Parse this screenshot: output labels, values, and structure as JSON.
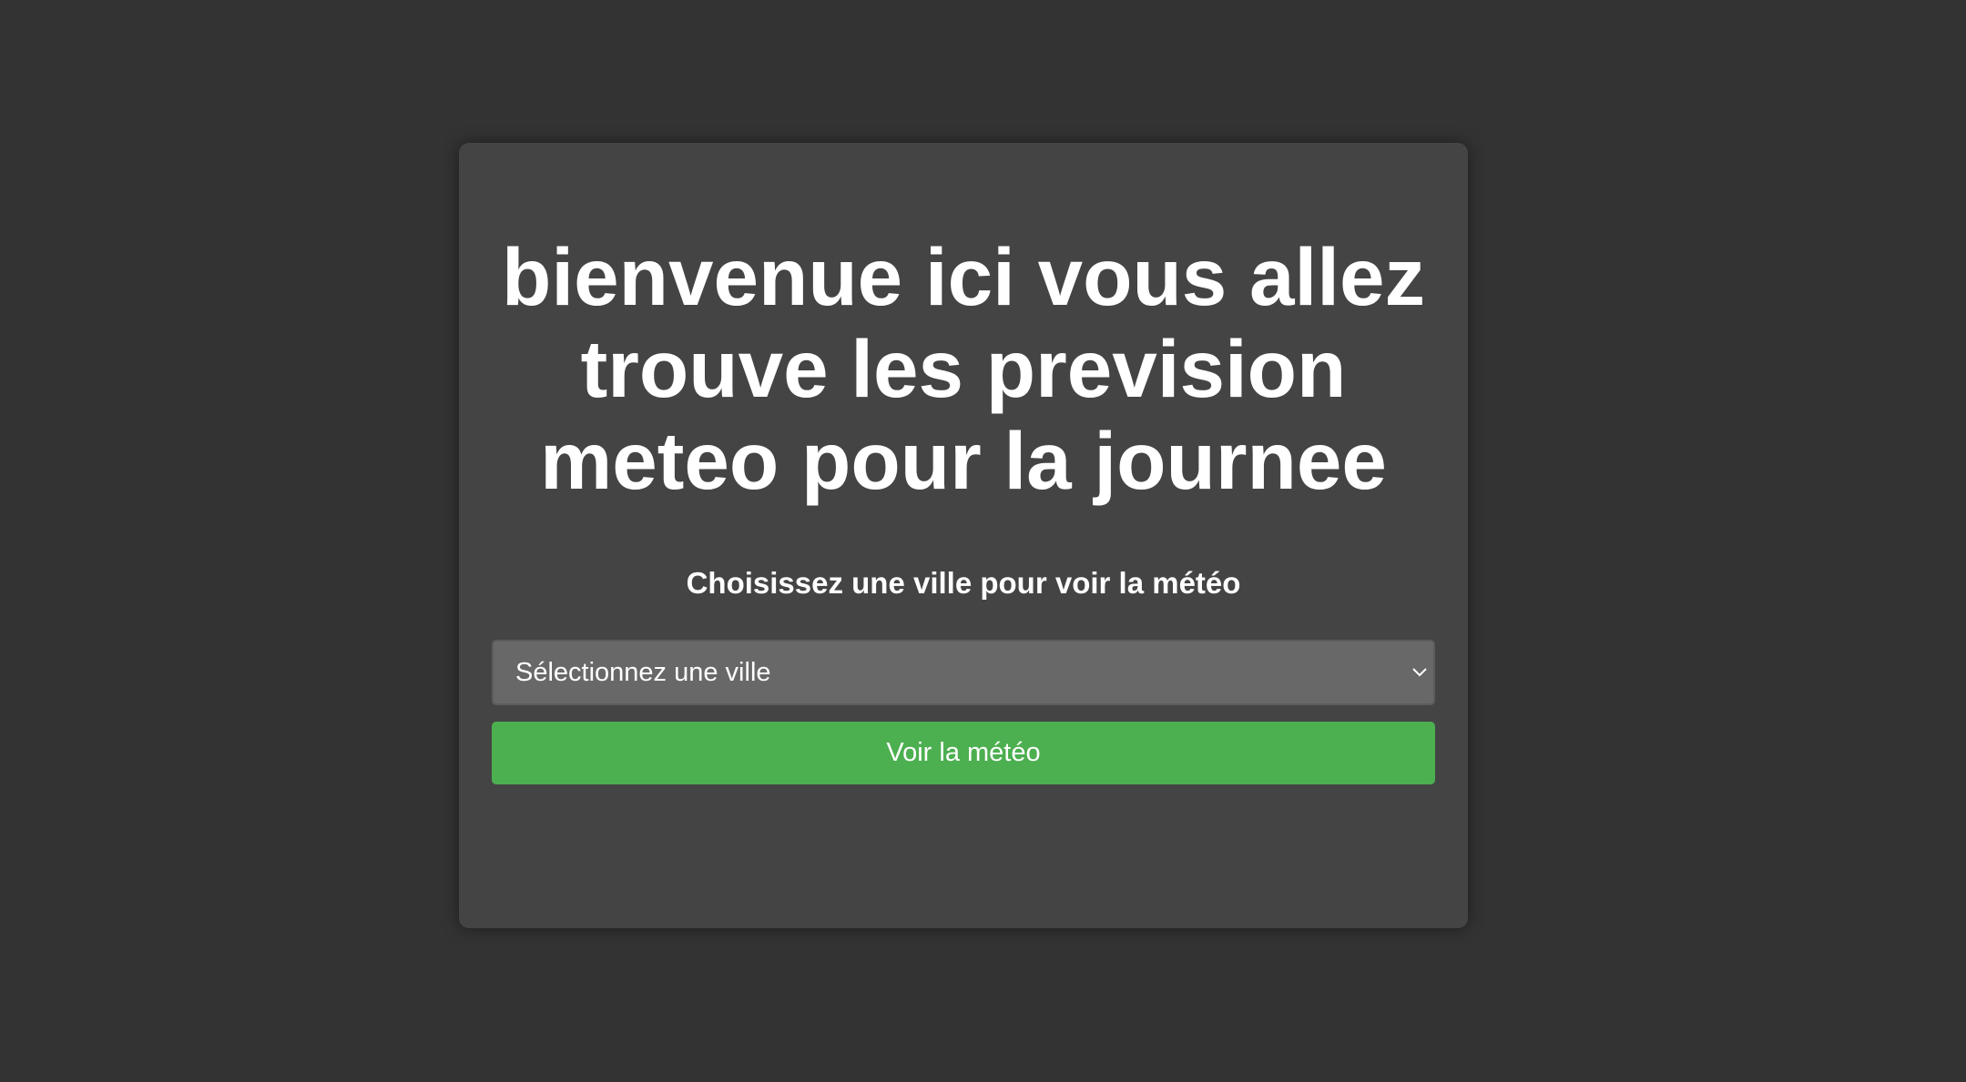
{
  "main": {
    "title": "bienvenue ici vous allez trouve les prevision meteo pour la journee",
    "subtitle": "Choisissez une ville pour voir la météo",
    "city_select": {
      "selected": "Sélectionnez une ville",
      "icon": "chevron-down-icon"
    },
    "submit_label": "Voir la météo"
  },
  "colors": {
    "background": "#333333",
    "card": "#444444",
    "select": "#686868",
    "button": "#4caf50",
    "text": "#ffffff"
  }
}
